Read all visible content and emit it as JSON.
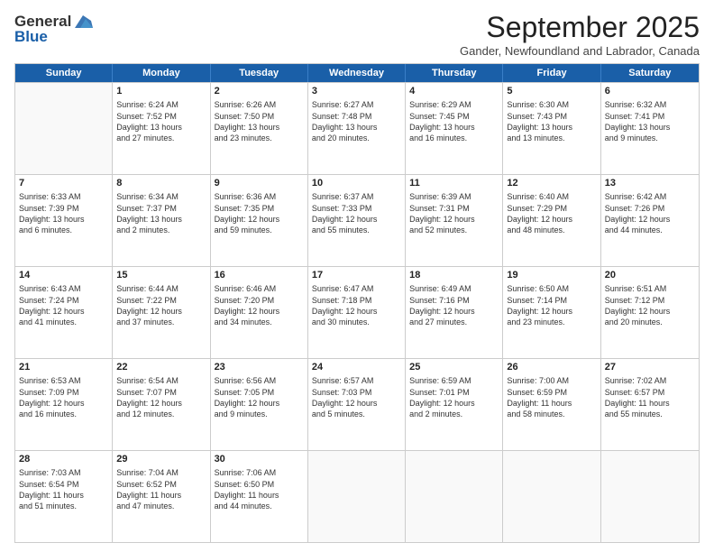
{
  "header": {
    "logo_line1": "General",
    "logo_line2": "Blue",
    "month_title": "September 2025",
    "location": "Gander, Newfoundland and Labrador, Canada"
  },
  "days_of_week": [
    "Sunday",
    "Monday",
    "Tuesday",
    "Wednesday",
    "Thursday",
    "Friday",
    "Saturday"
  ],
  "weeks": [
    [
      {
        "day": "",
        "info": ""
      },
      {
        "day": "1",
        "info": "Sunrise: 6:24 AM\nSunset: 7:52 PM\nDaylight: 13 hours\nand 27 minutes."
      },
      {
        "day": "2",
        "info": "Sunrise: 6:26 AM\nSunset: 7:50 PM\nDaylight: 13 hours\nand 23 minutes."
      },
      {
        "day": "3",
        "info": "Sunrise: 6:27 AM\nSunset: 7:48 PM\nDaylight: 13 hours\nand 20 minutes."
      },
      {
        "day": "4",
        "info": "Sunrise: 6:29 AM\nSunset: 7:45 PM\nDaylight: 13 hours\nand 16 minutes."
      },
      {
        "day": "5",
        "info": "Sunrise: 6:30 AM\nSunset: 7:43 PM\nDaylight: 13 hours\nand 13 minutes."
      },
      {
        "day": "6",
        "info": "Sunrise: 6:32 AM\nSunset: 7:41 PM\nDaylight: 13 hours\nand 9 minutes."
      }
    ],
    [
      {
        "day": "7",
        "info": "Sunrise: 6:33 AM\nSunset: 7:39 PM\nDaylight: 13 hours\nand 6 minutes."
      },
      {
        "day": "8",
        "info": "Sunrise: 6:34 AM\nSunset: 7:37 PM\nDaylight: 13 hours\nand 2 minutes."
      },
      {
        "day": "9",
        "info": "Sunrise: 6:36 AM\nSunset: 7:35 PM\nDaylight: 12 hours\nand 59 minutes."
      },
      {
        "day": "10",
        "info": "Sunrise: 6:37 AM\nSunset: 7:33 PM\nDaylight: 12 hours\nand 55 minutes."
      },
      {
        "day": "11",
        "info": "Sunrise: 6:39 AM\nSunset: 7:31 PM\nDaylight: 12 hours\nand 52 minutes."
      },
      {
        "day": "12",
        "info": "Sunrise: 6:40 AM\nSunset: 7:29 PM\nDaylight: 12 hours\nand 48 minutes."
      },
      {
        "day": "13",
        "info": "Sunrise: 6:42 AM\nSunset: 7:26 PM\nDaylight: 12 hours\nand 44 minutes."
      }
    ],
    [
      {
        "day": "14",
        "info": "Sunrise: 6:43 AM\nSunset: 7:24 PM\nDaylight: 12 hours\nand 41 minutes."
      },
      {
        "day": "15",
        "info": "Sunrise: 6:44 AM\nSunset: 7:22 PM\nDaylight: 12 hours\nand 37 minutes."
      },
      {
        "day": "16",
        "info": "Sunrise: 6:46 AM\nSunset: 7:20 PM\nDaylight: 12 hours\nand 34 minutes."
      },
      {
        "day": "17",
        "info": "Sunrise: 6:47 AM\nSunset: 7:18 PM\nDaylight: 12 hours\nand 30 minutes."
      },
      {
        "day": "18",
        "info": "Sunrise: 6:49 AM\nSunset: 7:16 PM\nDaylight: 12 hours\nand 27 minutes."
      },
      {
        "day": "19",
        "info": "Sunrise: 6:50 AM\nSunset: 7:14 PM\nDaylight: 12 hours\nand 23 minutes."
      },
      {
        "day": "20",
        "info": "Sunrise: 6:51 AM\nSunset: 7:12 PM\nDaylight: 12 hours\nand 20 minutes."
      }
    ],
    [
      {
        "day": "21",
        "info": "Sunrise: 6:53 AM\nSunset: 7:09 PM\nDaylight: 12 hours\nand 16 minutes."
      },
      {
        "day": "22",
        "info": "Sunrise: 6:54 AM\nSunset: 7:07 PM\nDaylight: 12 hours\nand 12 minutes."
      },
      {
        "day": "23",
        "info": "Sunrise: 6:56 AM\nSunset: 7:05 PM\nDaylight: 12 hours\nand 9 minutes."
      },
      {
        "day": "24",
        "info": "Sunrise: 6:57 AM\nSunset: 7:03 PM\nDaylight: 12 hours\nand 5 minutes."
      },
      {
        "day": "25",
        "info": "Sunrise: 6:59 AM\nSunset: 7:01 PM\nDaylight: 12 hours\nand 2 minutes."
      },
      {
        "day": "26",
        "info": "Sunrise: 7:00 AM\nSunset: 6:59 PM\nDaylight: 11 hours\nand 58 minutes."
      },
      {
        "day": "27",
        "info": "Sunrise: 7:02 AM\nSunset: 6:57 PM\nDaylight: 11 hours\nand 55 minutes."
      }
    ],
    [
      {
        "day": "28",
        "info": "Sunrise: 7:03 AM\nSunset: 6:54 PM\nDaylight: 11 hours\nand 51 minutes."
      },
      {
        "day": "29",
        "info": "Sunrise: 7:04 AM\nSunset: 6:52 PM\nDaylight: 11 hours\nand 47 minutes."
      },
      {
        "day": "30",
        "info": "Sunrise: 7:06 AM\nSunset: 6:50 PM\nDaylight: 11 hours\nand 44 minutes."
      },
      {
        "day": "",
        "info": ""
      },
      {
        "day": "",
        "info": ""
      },
      {
        "day": "",
        "info": ""
      },
      {
        "day": "",
        "info": ""
      }
    ]
  ]
}
